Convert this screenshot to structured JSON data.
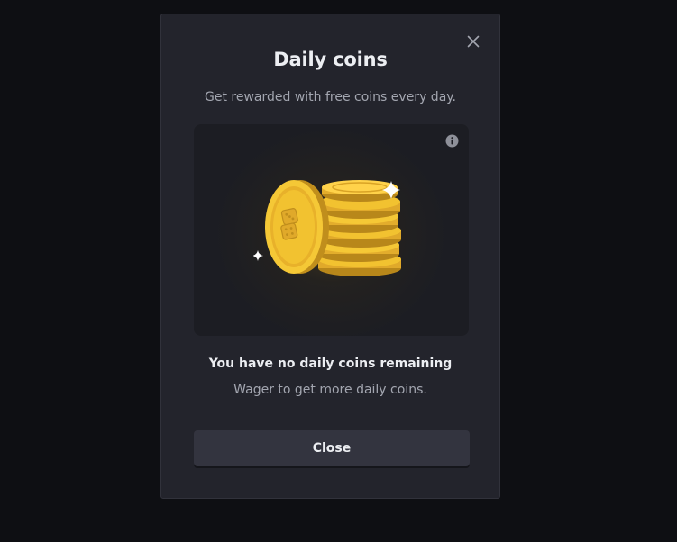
{
  "modal": {
    "title": "Daily coins",
    "subtitle": "Get rewarded with free coins every day.",
    "status_title": "You have no daily coins remaining",
    "status_subtitle": "Wager to get more daily coins.",
    "close_button_label": "Close",
    "close_icon": "close-icon",
    "info_icon": "info-icon",
    "illustration": "coin-stack-illustration"
  },
  "colors": {
    "background": "#0e0f13",
    "modal": "#23242c",
    "hero": "#1c1d23",
    "button": "#33343f",
    "coin_gold": "#f2c230",
    "text_primary": "#eceef2",
    "text_secondary": "#a3a6b0"
  }
}
